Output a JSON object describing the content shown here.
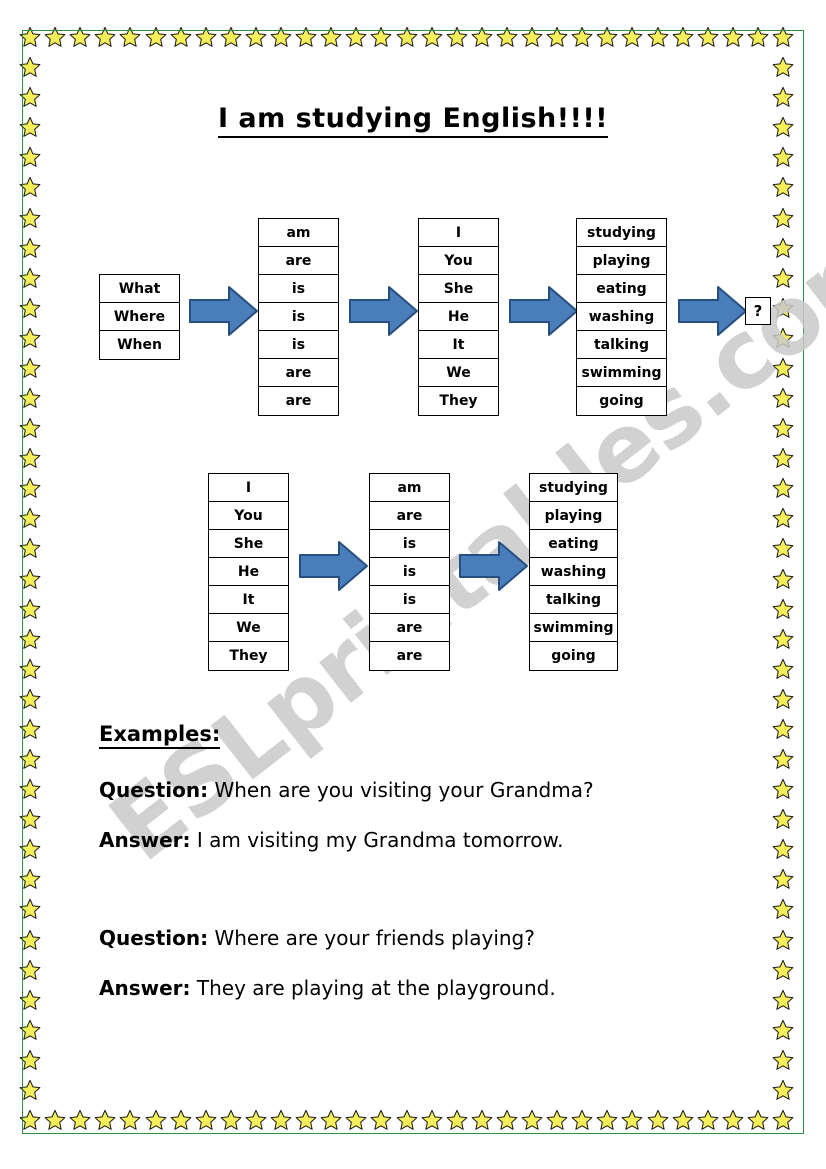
{
  "page": {
    "title": "I am studying English!!!!",
    "watermark": "ESLprintables.com",
    "border_color": "#2f8f3f",
    "star_color": "#f7ef5a",
    "arrow_color": "#4a7ebb",
    "arrow_outline_color": "#254f7e"
  },
  "row1": {
    "question_words": {
      "label": "question-words",
      "items": [
        "What",
        "Where",
        "When"
      ]
    },
    "be_verbs": {
      "label": "be-verbs",
      "items": [
        "am",
        "are",
        "is",
        "is",
        "is",
        "are",
        "are"
      ]
    },
    "pronouns": {
      "label": "pronouns",
      "items": [
        "I",
        "You",
        "She",
        "He",
        "It",
        "We",
        "They"
      ]
    },
    "verbs_ing": {
      "label": "present-participles",
      "items": [
        "studying",
        "playing",
        "eating",
        "washing",
        "talking",
        "swimming",
        "going"
      ]
    },
    "end_marker": "?"
  },
  "row2": {
    "pronouns": {
      "label": "pronouns",
      "items": [
        "I",
        "You",
        "She",
        "He",
        "It",
        "We",
        "They"
      ]
    },
    "be_verbs": {
      "label": "be-verbs",
      "items": [
        "am",
        "are",
        "is",
        "is",
        "is",
        "are",
        "are"
      ]
    },
    "verbs_ing": {
      "label": "present-participles",
      "items": [
        "studying",
        "playing",
        "eating",
        "washing",
        "talking",
        "swimming",
        "going"
      ]
    }
  },
  "examples": {
    "heading": "Examples:",
    "items": [
      {
        "q_label": "Question:",
        "q_text": "When are you visiting your Grandma?",
        "a_label": "Answer:",
        "a_text": "I am visiting my Grandma tomorrow."
      },
      {
        "q_label": "Question:",
        "q_text": "Where are your friends playing?",
        "a_label": "Answer:",
        "a_text": "They are playing at the playground."
      }
    ]
  }
}
